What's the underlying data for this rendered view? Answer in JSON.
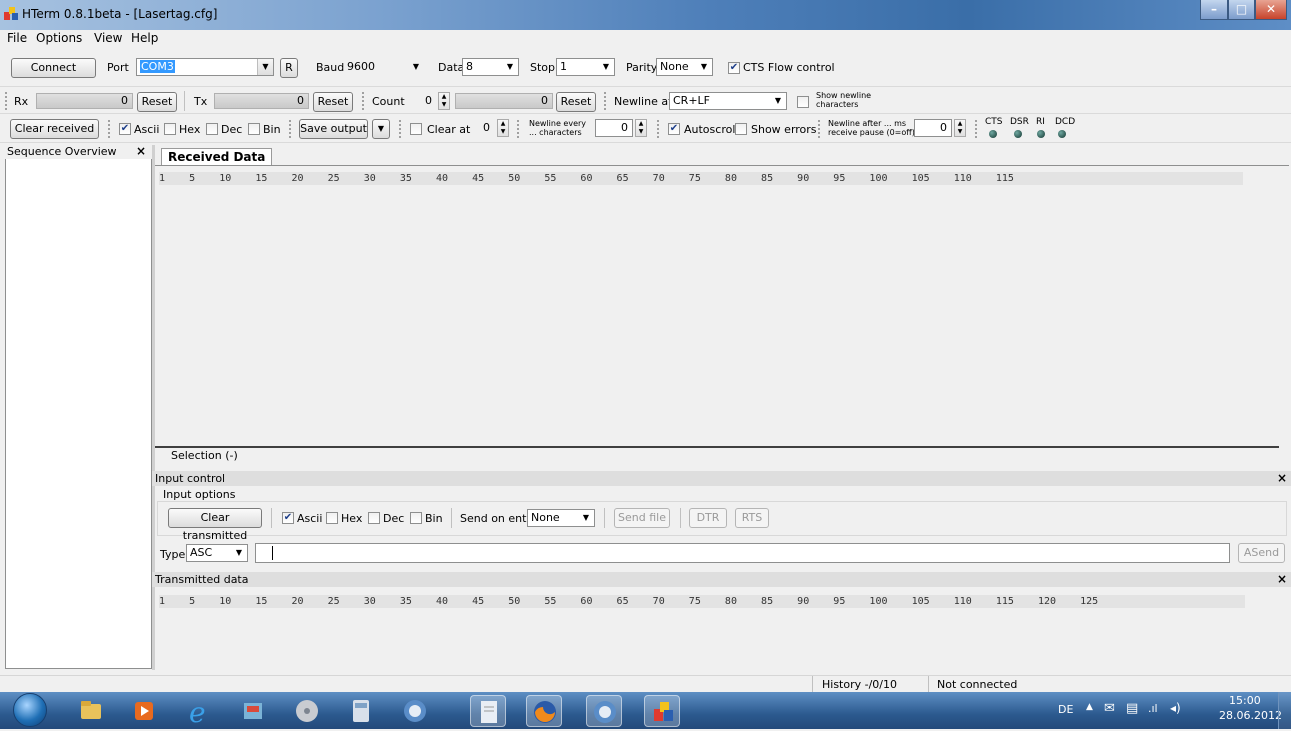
{
  "window": {
    "title": "HTerm 0.8.1beta - [Lasertag.cfg]",
    "controls": [
      "minimize",
      "maximize",
      "close"
    ]
  },
  "menu": [
    "File",
    "Options",
    "View",
    "Help"
  ],
  "connection": {
    "connect_label": "Connect",
    "port_label": "Port",
    "port_value": "COM3",
    "r_label": "R",
    "baud_label": "Baud",
    "baud_value": "9600",
    "data_label": "Data",
    "data_value": "8",
    "stop_label": "Stop",
    "stop_value": "1",
    "parity_label": "Parity",
    "parity_value": "None",
    "cts_flow_label": "CTS Flow control",
    "cts_flow_checked": true
  },
  "counters": {
    "rx_label": "Rx",
    "rx_value": "0",
    "rx_reset": "Reset",
    "tx_label": "Tx",
    "tx_value": "0",
    "tx_reset": "Reset",
    "count_label": "Count",
    "count_value": "0",
    "count_bar_value": "0",
    "count_reset": "Reset",
    "newline_at_label": "Newline at",
    "newline_at_value": "CR+LF",
    "show_newline_label_1": "Show newline",
    "show_newline_label_2": "characters"
  },
  "receive_options": {
    "clear_received": "Clear received",
    "ascii": "Ascii",
    "hex": "Hex",
    "dec": "Dec",
    "bin": "Bin",
    "save_output": "Save output",
    "clear_at": "Clear at",
    "clear_at_value": "0",
    "newline_every_1": "Newline every",
    "newline_every_2": "... characters",
    "newline_every_value": "0",
    "autoscroll": "Autoscroll",
    "show_errors": "Show errors",
    "newline_after_1": "Newline after ... ms",
    "newline_after_2": "receive pause (0=off)",
    "newline_after_value": "0",
    "leds": [
      "CTS",
      "DSR",
      "RI",
      "DCD"
    ]
  },
  "sequence_panel": {
    "title": "Sequence Overview",
    "close": "×"
  },
  "received": {
    "tab": "Received Data",
    "ruler": "1    5    10    15    20    25    30    35    40    45    50    55    60    65    70    75    80    85    90    95    100    105    110    115",
    "selection": "Selection (-)"
  },
  "input_control": {
    "title": "Input control",
    "close": "×",
    "options_title": "Input options",
    "clear_transmitted": "Clear transmitted",
    "ascii": "Ascii",
    "hex": "Hex",
    "dec": "Dec",
    "bin": "Bin",
    "send_on_enter_label": "Send on enter",
    "send_on_enter_value": "None",
    "send_file": "Send file",
    "dtr": "DTR",
    "rts": "RTS",
    "type_label": "Type",
    "type_value": "ASC",
    "input_value": "",
    "asend": "ASend"
  },
  "transmitted": {
    "title": "Transmitted data",
    "close": "×",
    "ruler": "1    5    10    15    20    25    30    35    40    45    50    55    60    65    70    75    80    85    90    95    100    105    110    115    120    125"
  },
  "status": {
    "history": "History -/0/10",
    "connection": "Not connected"
  },
  "taskbar": {
    "lang": "DE",
    "time": "15:00",
    "date": "28.06.2012"
  },
  "colors": {
    "selection_highlight": "#3399ff",
    "led": "#1d4a42",
    "taskbar": "#2c5a8f"
  }
}
